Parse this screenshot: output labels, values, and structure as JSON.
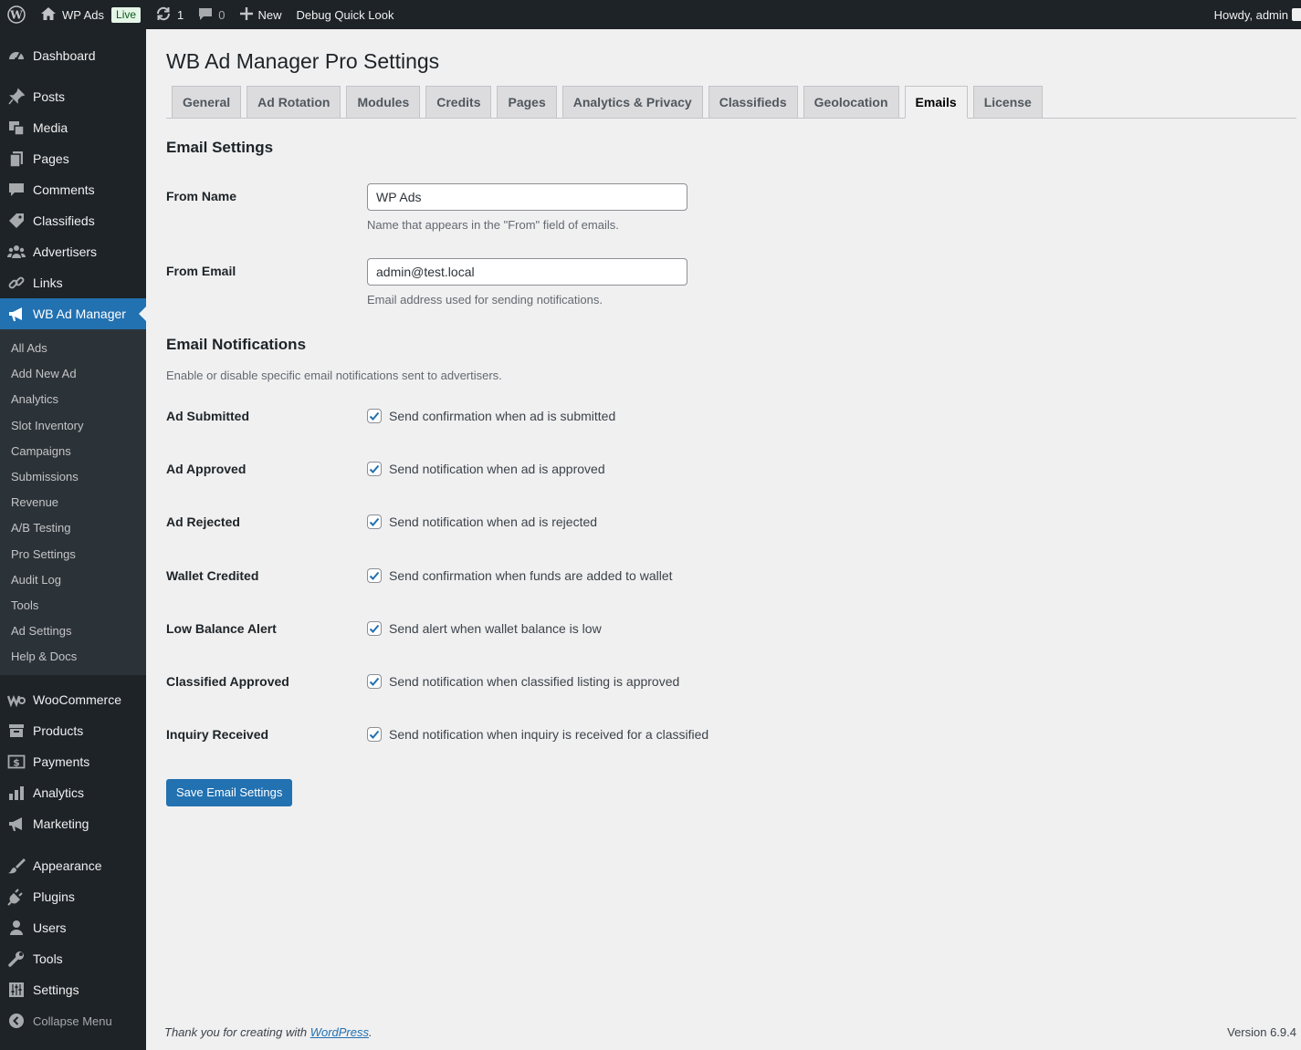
{
  "adminbar": {
    "site_name": "WP Ads",
    "live_badge": "Live",
    "updates_count": "1",
    "comments_count": "0",
    "new_label": "New",
    "debug_label": "Debug Quick Look",
    "howdy": "Howdy, admin"
  },
  "sidebar": {
    "items_top": [
      {
        "label": "Dashboard",
        "icon": "dashboard-icon"
      },
      {
        "label": "Posts",
        "icon": "pin-icon"
      },
      {
        "label": "Media",
        "icon": "media-icon"
      },
      {
        "label": "Pages",
        "icon": "pages-icon"
      },
      {
        "label": "Comments",
        "icon": "comment-icon"
      },
      {
        "label": "Classifieds",
        "icon": "tag-icon"
      },
      {
        "label": "Advertisers",
        "icon": "groups-icon"
      },
      {
        "label": "Links",
        "icon": "link-icon"
      },
      {
        "label": "WB Ad Manager",
        "icon": "megaphone-icon"
      }
    ],
    "submenu": [
      "All Ads",
      "Add New Ad",
      "Analytics",
      "Slot Inventory",
      "Campaigns",
      "Submissions",
      "Revenue",
      "A/B Testing",
      "Pro Settings",
      "Audit Log",
      "Tools",
      "Ad Settings",
      "Help & Docs"
    ],
    "items_mid": [
      {
        "label": "WooCommerce",
        "icon": "woo-icon"
      },
      {
        "label": "Products",
        "icon": "archive-icon"
      },
      {
        "label": "Payments",
        "icon": "dollar-icon"
      },
      {
        "label": "Analytics",
        "icon": "bar-chart-icon"
      },
      {
        "label": "Marketing",
        "icon": "megaphone-icon"
      }
    ],
    "items_bottom": [
      {
        "label": "Appearance",
        "icon": "brush-icon"
      },
      {
        "label": "Plugins",
        "icon": "plug-icon"
      },
      {
        "label": "Users",
        "icon": "user-icon"
      },
      {
        "label": "Tools",
        "icon": "wrench-icon"
      },
      {
        "label": "Settings",
        "icon": "sliders-icon"
      }
    ],
    "collapse_label": "Collapse Menu"
  },
  "page": {
    "title": "WB Ad Manager Pro Settings",
    "tabs": [
      "General",
      "Ad Rotation",
      "Modules",
      "Credits",
      "Pages",
      "Analytics & Privacy",
      "Classifieds",
      "Geolocation",
      "Emails",
      "License"
    ],
    "active_tab": "Emails"
  },
  "email_settings": {
    "heading": "Email Settings",
    "from_name_label": "From Name",
    "from_name_value": "WP Ads",
    "from_name_desc": "Name that appears in the \"From\" field of emails.",
    "from_email_label": "From Email",
    "from_email_value": "admin@test.local",
    "from_email_desc": "Email address used for sending notifications."
  },
  "notifications": {
    "heading": "Email Notifications",
    "description": "Enable or disable specific email notifications sent to advertisers.",
    "rows": [
      {
        "label": "Ad Submitted",
        "text": "Send confirmation when ad is submitted",
        "checked": true
      },
      {
        "label": "Ad Approved",
        "text": "Send notification when ad is approved",
        "checked": true
      },
      {
        "label": "Ad Rejected",
        "text": "Send notification when ad is rejected",
        "checked": true
      },
      {
        "label": "Wallet Credited",
        "text": "Send confirmation when funds are added to wallet",
        "checked": true
      },
      {
        "label": "Low Balance Alert",
        "text": "Send alert when wallet balance is low",
        "checked": true
      },
      {
        "label": "Classified Approved",
        "text": "Send notification when classified listing is approved",
        "checked": true
      },
      {
        "label": "Inquiry Received",
        "text": "Send notification when inquiry is received for a classified",
        "checked": true
      }
    ]
  },
  "save_button": "Save Email Settings",
  "footer": {
    "thanks_prefix": "Thank you for creating with ",
    "thanks_link": "WordPress",
    "thanks_suffix": ".",
    "version": "Version 6.9.4"
  },
  "colors": {
    "accent": "#2271b1",
    "sidebar_bg": "#1d2327",
    "submenu_bg": "#2c3338",
    "live_badge_bg": "#e5f5e8"
  }
}
